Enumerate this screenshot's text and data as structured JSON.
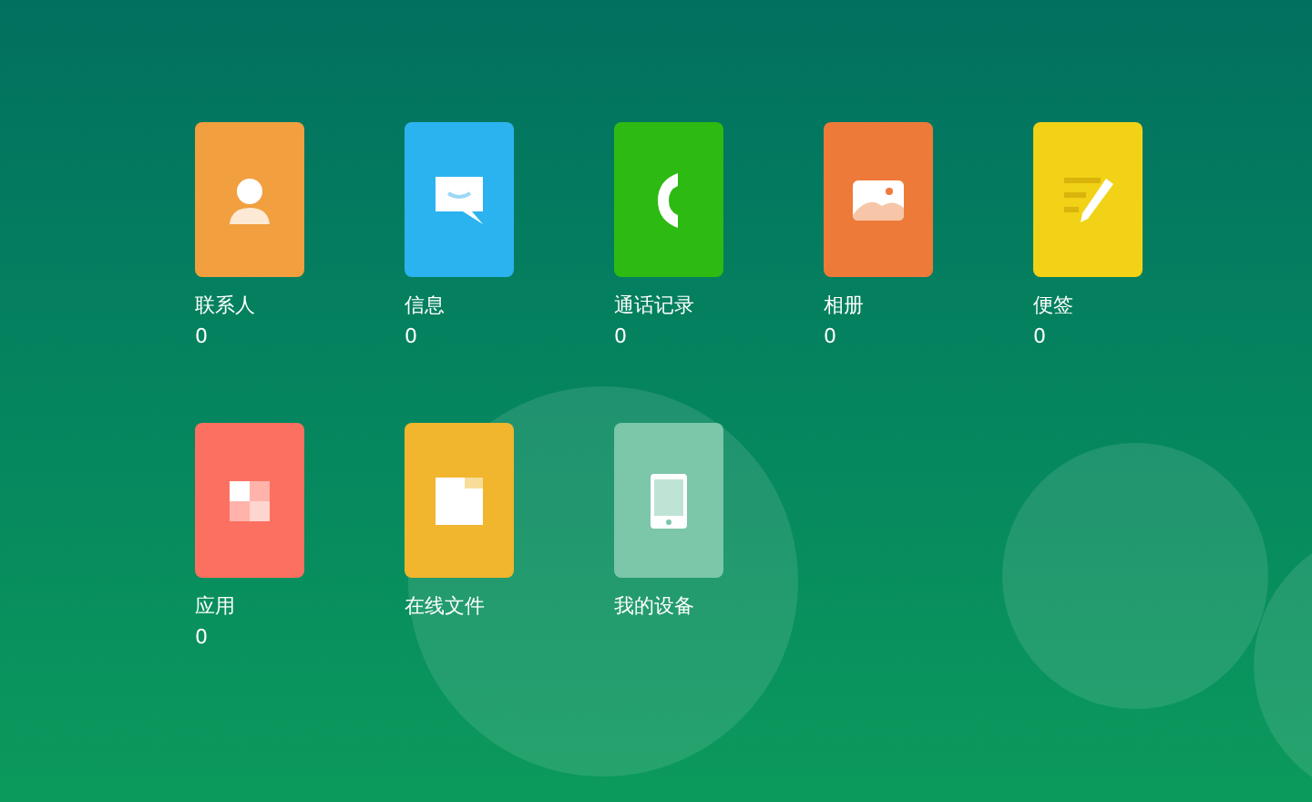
{
  "apps": [
    {
      "kind": "contacts",
      "label": "联系人",
      "count": "0",
      "color": "#f19f3f"
    },
    {
      "kind": "messages",
      "label": "信息",
      "count": "0",
      "color": "#2bb3ef"
    },
    {
      "kind": "calls",
      "label": "通话记录",
      "count": "0",
      "color": "#2dba12"
    },
    {
      "kind": "photos",
      "label": "相册",
      "count": "0",
      "color": "#ee7a3a"
    },
    {
      "kind": "notes",
      "label": "便签",
      "count": "0",
      "color": "#f1d216"
    },
    {
      "kind": "apps",
      "label": "应用",
      "count": "0",
      "color": "#fb7060"
    },
    {
      "kind": "files",
      "label": "在线文件",
      "color": "#f1b52e"
    },
    {
      "kind": "device",
      "label": "我的设备",
      "color": "#7cc6aa"
    }
  ]
}
